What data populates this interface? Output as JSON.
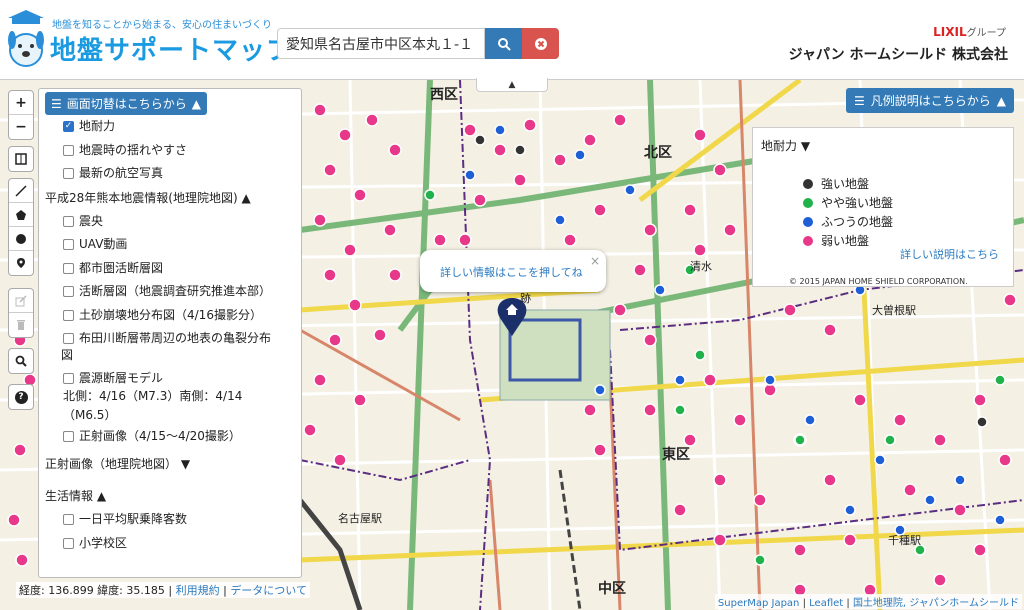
{
  "header": {
    "tagline": "地盤を知ることから始まる、安心の住まいづくり",
    "title": "地盤サポートマップ",
    "search_value": "愛知県名古屋市中区本丸１-１",
    "brand_lixil": "LIXIL",
    "brand_group": "グループ",
    "company": "ジャパン ホームシールド 株式会社"
  },
  "layer_panel": {
    "toggle_label": "画面切替はこちらから",
    "top_items": [
      {
        "label": "地耐力",
        "checked": true
      },
      {
        "label": "地震時の揺れやすさ",
        "checked": false
      },
      {
        "label": "最新の航空写真",
        "checked": false
      }
    ],
    "kumamoto": {
      "title": "平成28年熊本地震情報(地理院地図)",
      "items": [
        "震央",
        "UAV動画",
        "都市圏活断層図",
        "活断層図（地震調査研究推進本部）",
        "土砂崩壊地分布図（4/16撮影分）",
        "布田川断層帯周辺の地表の亀裂分布図",
        "震源断層モデル"
      ],
      "note": "北側：4/16（M7.3）南側：4/14（M6.5）",
      "last_item": "正射画像（4/15〜4/20撮影）"
    },
    "orthophoto_title": "正射画像（地理院地図）",
    "life": {
      "title": "生活情報",
      "items": [
        "一日平均駅乗降客数",
        "小学校区"
      ]
    }
  },
  "legend": {
    "toggle_label": "凡例説明はこちらから",
    "title": "地耐力",
    "items": [
      {
        "label": "強い地盤",
        "color": "#333333"
      },
      {
        "label": "やや強い地盤",
        "color": "#22b24c"
      },
      {
        "label": "ふつうの地盤",
        "color": "#1f5fd6"
      },
      {
        "label": "弱い地盤",
        "color": "#e8388a"
      }
    ],
    "detail_link": "詳しい説明はこちら",
    "copyright": "© 2015 JAPAN HOME SHIELD CORPORATION."
  },
  "popup": {
    "text": "詳しい情報はここを押してね",
    "close": "×"
  },
  "map_labels": {
    "nishi": "西区",
    "kita": "北区",
    "higashi": "東区",
    "naka": "中区",
    "nagoya_station": "名古屋駅",
    "ozone_station": "大曽根駅",
    "chikusa_station": "千種駅",
    "ato": "跡",
    "shimizu": "清水"
  },
  "coords": {
    "text": "経度: 136.899 緯度: 35.185 |",
    "terms": "利用規約",
    "sep": "|",
    "data_link": "データについて"
  },
  "attribution": {
    "parts": [
      "SuperMap Japan",
      "Leaflet",
      "国土地理院, ジャパンホームシールド"
    ],
    "sep": " | "
  },
  "tools": {
    "zoom_in": "+",
    "zoom_out": "−",
    "help": "?"
  },
  "colors": {
    "primary": "#337ab7",
    "danger": "#d9534f",
    "title": "#1a9ae0"
  }
}
